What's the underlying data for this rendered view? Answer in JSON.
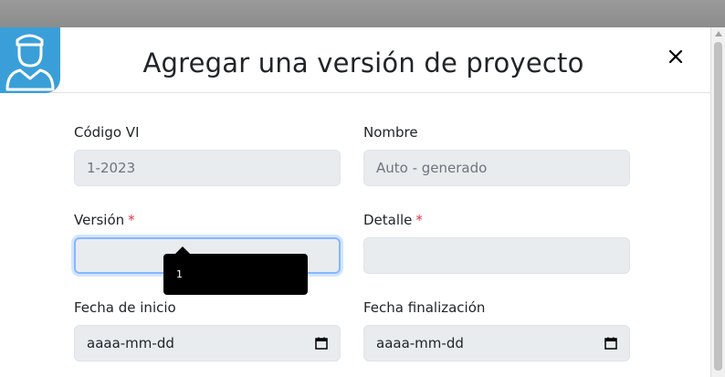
{
  "modal": {
    "title": "Agregar una versión de proyecto"
  },
  "icons": {
    "avatar": "user-avatar-icon",
    "close": "close-icon",
    "calendar": "calendar-icon"
  },
  "colors": {
    "accent": "#3a9fd8",
    "required": "#dc3545",
    "focus": "#86b7fe",
    "input_bg": "#e9ecef"
  },
  "form": {
    "codigo": {
      "label": "Código VI",
      "value": "1-2023"
    },
    "nombre": {
      "label": "Nombre",
      "placeholder": "Auto - generado"
    },
    "version": {
      "label": "Versión",
      "required": "*",
      "value": ""
    },
    "detalle": {
      "label": "Detalle",
      "required": "*",
      "value": ""
    },
    "fecha_inicio": {
      "label": "Fecha de inicio",
      "placeholder": "aaaa-mm-dd"
    },
    "fecha_fin": {
      "label": "Fecha finalización",
      "placeholder": "aaaa-mm-dd"
    }
  },
  "tooltip": {
    "text": "1"
  }
}
